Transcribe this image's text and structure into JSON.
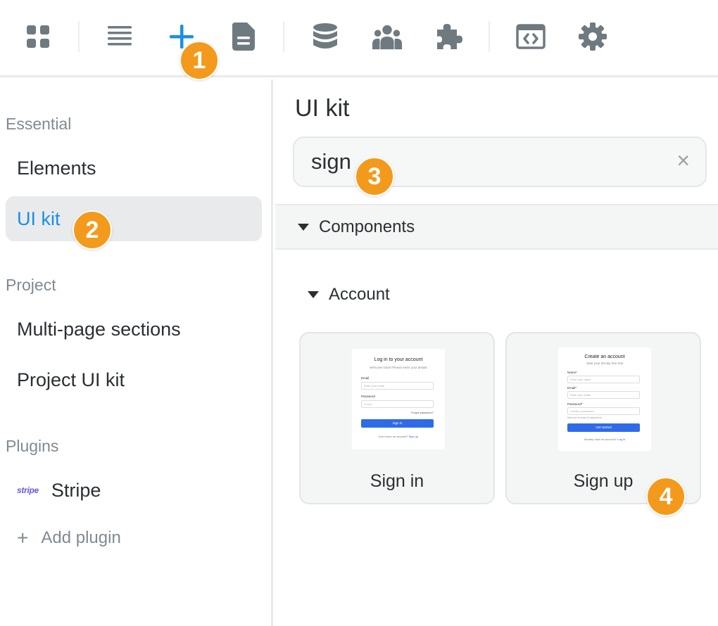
{
  "toolbar": {
    "icons": [
      "grid-icon",
      "list-icon",
      "plus-icon",
      "document-icon",
      "database-icon",
      "users-icon",
      "puzzle-icon",
      "code-icon",
      "gear-icon"
    ],
    "active": "plus-icon",
    "accent": "#1a8fe3"
  },
  "sidebar": {
    "essential_label": "Essential",
    "essential_items": [
      {
        "label": "Elements"
      },
      {
        "label": "UI kit",
        "active": true
      }
    ],
    "project_label": "Project",
    "project_items": [
      {
        "label": "Multi-page sections"
      },
      {
        "label": "Project UI kit"
      }
    ],
    "plugins_label": "Plugins",
    "plugins": [
      {
        "logo": "stripe",
        "label": "Stripe"
      }
    ],
    "add_plugin_label": "Add plugin"
  },
  "main": {
    "title": "UI kit",
    "search": {
      "value": "sign",
      "clear_icon": "×"
    },
    "components_label": "Components",
    "account_label": "Account",
    "cards": [
      {
        "label": "Sign in",
        "preview": {
          "title": "Log in to your account",
          "subtitle": "Welcome back! Please enter your details",
          "email_label": "Email",
          "email_placeholder": "Enter your email",
          "password_label": "Password",
          "password_placeholder": "••••••••",
          "forgot": "Forgot password?",
          "button": "Sign in",
          "footer_text": "Don't have an account?",
          "footer_link": "Sign up"
        }
      },
      {
        "label": "Sign up",
        "preview": {
          "title": "Create an account",
          "subtitle": "Start your 30-day free trial",
          "name_label": "Name*",
          "name_placeholder": "Enter your name",
          "email_label": "Email*",
          "email_placeholder": "Enter your email",
          "password_label": "Password*",
          "password_placeholder": "Create a password",
          "hint": "Must be at least 8 characters",
          "button": "Get started",
          "footer_text": "Already have an account?",
          "footer_link": "Log in"
        }
      }
    ]
  },
  "annotations": [
    "1",
    "2",
    "3",
    "4"
  ],
  "colors": {
    "badge": "#f39a1d",
    "accent": "#1a8fe3",
    "icon": "#6f7a80"
  }
}
